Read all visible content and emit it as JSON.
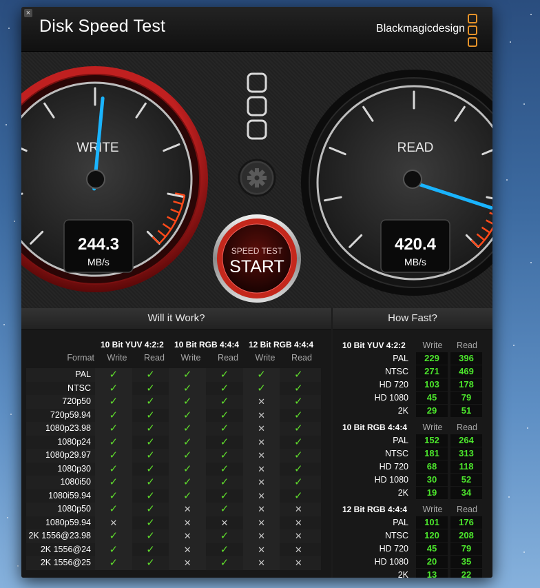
{
  "app": {
    "title": "Disk Speed Test",
    "brand": "Blackmagicdesign",
    "close_glyph": "×"
  },
  "gauges": {
    "write": {
      "label": "WRITE",
      "value": "244.3",
      "unit": "MB/s",
      "needle_fraction": 0.52
    },
    "read": {
      "label": "READ",
      "value": "420.4",
      "unit": "MB/s",
      "needle_fraction": 0.9
    }
  },
  "controls": {
    "start_top": "SPEED TEST",
    "start_main": "START"
  },
  "will_it_work": {
    "title": "Will it Work?",
    "format_header": "Format",
    "groups": [
      "10 Bit YUV 4:2:2",
      "10 Bit RGB 4:4:4",
      "12 Bit RGB 4:4:4"
    ],
    "col_write": "Write",
    "col_read": "Read",
    "rows": [
      {
        "format": "PAL",
        "results": [
          1,
          1,
          1,
          1,
          1,
          1
        ]
      },
      {
        "format": "NTSC",
        "results": [
          1,
          1,
          1,
          1,
          1,
          1
        ]
      },
      {
        "format": "720p50",
        "results": [
          1,
          1,
          1,
          1,
          0,
          1
        ]
      },
      {
        "format": "720p59.94",
        "results": [
          1,
          1,
          1,
          1,
          0,
          1
        ]
      },
      {
        "format": "1080p23.98",
        "results": [
          1,
          1,
          1,
          1,
          0,
          1
        ]
      },
      {
        "format": "1080p24",
        "results": [
          1,
          1,
          1,
          1,
          0,
          1
        ]
      },
      {
        "format": "1080p29.97",
        "results": [
          1,
          1,
          1,
          1,
          0,
          1
        ]
      },
      {
        "format": "1080p30",
        "results": [
          1,
          1,
          1,
          1,
          0,
          1
        ]
      },
      {
        "format": "1080i50",
        "results": [
          1,
          1,
          1,
          1,
          0,
          1
        ]
      },
      {
        "format": "1080i59.94",
        "results": [
          1,
          1,
          1,
          1,
          0,
          1
        ]
      },
      {
        "format": "1080p50",
        "results": [
          1,
          1,
          0,
          1,
          0,
          0
        ]
      },
      {
        "format": "1080p59.94",
        "results": [
          0,
          1,
          0,
          0,
          0,
          0
        ]
      },
      {
        "format": "2K 1556@23.98",
        "results": [
          1,
          1,
          0,
          1,
          0,
          0
        ]
      },
      {
        "format": "2K 1556@24",
        "results": [
          1,
          1,
          0,
          1,
          0,
          0
        ]
      },
      {
        "format": "2K 1556@25",
        "results": [
          1,
          1,
          0,
          1,
          0,
          0
        ]
      }
    ]
  },
  "how_fast": {
    "title": "How Fast?",
    "col_write": "Write",
    "col_read": "Read",
    "groups": [
      {
        "name": "10 Bit YUV 4:2:2",
        "rows": [
          {
            "format": "PAL",
            "write": "229",
            "read": "396"
          },
          {
            "format": "NTSC",
            "write": "271",
            "read": "469"
          },
          {
            "format": "HD 720",
            "write": "103",
            "read": "178"
          },
          {
            "format": "HD 1080",
            "write": "45",
            "read": "79"
          },
          {
            "format": "2K",
            "write": "29",
            "read": "51"
          }
        ]
      },
      {
        "name": "10 Bit RGB 4:4:4",
        "rows": [
          {
            "format": "PAL",
            "write": "152",
            "read": "264"
          },
          {
            "format": "NTSC",
            "write": "181",
            "read": "313"
          },
          {
            "format": "HD 720",
            "write": "68",
            "read": "118"
          },
          {
            "format": "HD 1080",
            "write": "30",
            "read": "52"
          },
          {
            "format": "2K",
            "write": "19",
            "read": "34"
          }
        ]
      },
      {
        "name": "12 Bit RGB 4:4:4",
        "rows": [
          {
            "format": "PAL",
            "write": "101",
            "read": "176"
          },
          {
            "format": "NTSC",
            "write": "120",
            "read": "208"
          },
          {
            "format": "HD 720",
            "write": "45",
            "read": "79"
          },
          {
            "format": "HD 1080",
            "write": "20",
            "read": "35"
          },
          {
            "format": "2K",
            "write": "13",
            "read": "22"
          }
        ]
      }
    ]
  },
  "icons": {
    "check": "✓",
    "cross": "✕",
    "settings": "gear-icon",
    "logo": "blackmagic-logo-icon"
  },
  "colors": {
    "accent_orange": "#e7932a",
    "needle_blue": "#1ab4ff",
    "ok_green": "#5fdc2c",
    "speed_green": "#4ce62c",
    "start_red": "#c4281c",
    "write_bezel": "#a41a1a"
  }
}
